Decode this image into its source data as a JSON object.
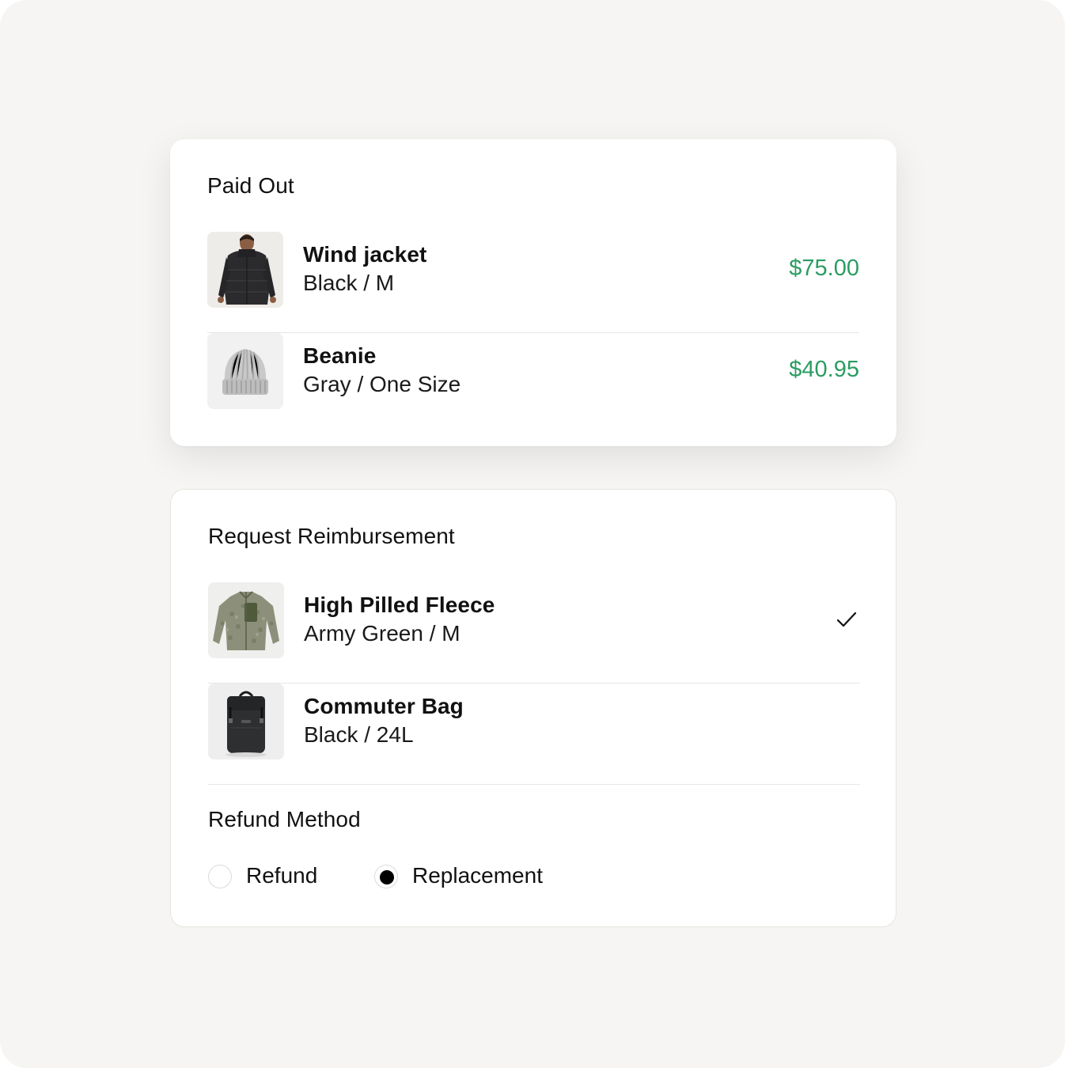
{
  "paid_out": {
    "title": "Paid Out",
    "items": [
      {
        "name": "Wind jacket",
        "variant": "Black / M",
        "price": "$75.00",
        "thumbnail": "black-puffer-jacket-photo"
      },
      {
        "name": "Beanie",
        "variant": "Gray / One Size",
        "price": "$40.95",
        "thumbnail": "gray-beanie-photo"
      }
    ]
  },
  "request_reimbursement": {
    "title": "Request Reimbursement",
    "items": [
      {
        "name": "High Pilled Fleece",
        "variant": "Army Green / M",
        "selected": true,
        "thumbnail": "green-fleece-jacket-photo",
        "selected_icon": "check-icon"
      },
      {
        "name": "Commuter Bag",
        "variant": "Black / 24L",
        "selected": false,
        "thumbnail": "black-backpack-photo"
      }
    ]
  },
  "refund_method": {
    "title": "Refund Method",
    "options": [
      {
        "label": "Refund",
        "selected": false
      },
      {
        "label": "Replacement",
        "selected": true
      }
    ]
  },
  "colors": {
    "price": "#2a9d62",
    "background": "#f6f5f3",
    "card": "#ffffff",
    "radio_selected": "#000000"
  }
}
